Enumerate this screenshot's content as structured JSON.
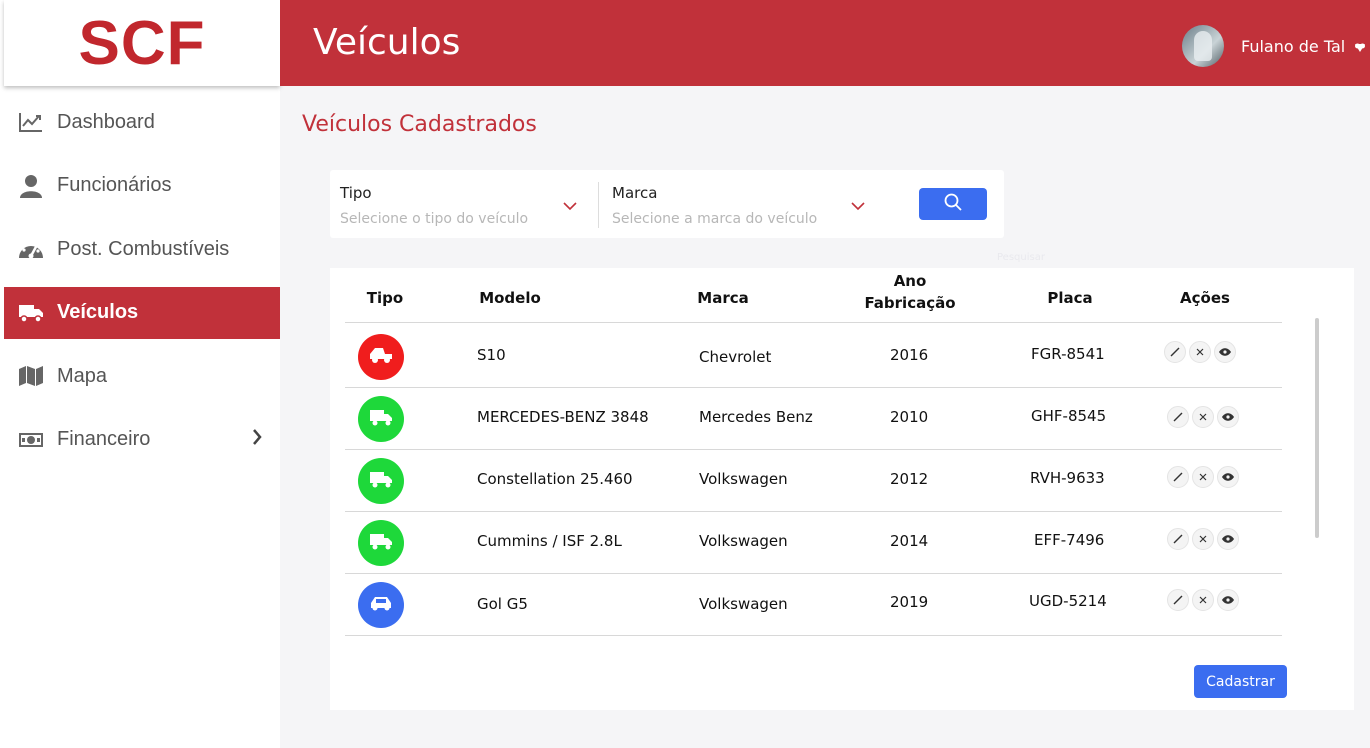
{
  "app": {
    "logo": "SCF"
  },
  "sidebar": {
    "items": [
      {
        "label": "Dashboard",
        "icon": "chart-line-icon",
        "active": false
      },
      {
        "label": "Funcionários",
        "icon": "user-icon",
        "active": false
      },
      {
        "label": "Post. Combustíveis",
        "icon": "gauge-icon",
        "active": false
      },
      {
        "label": "Veículos",
        "icon": "truck-icon",
        "active": true
      },
      {
        "label": "Mapa",
        "icon": "map-icon",
        "active": false
      },
      {
        "label": "Financeiro",
        "icon": "money-icon",
        "active": false,
        "has_submenu": true
      }
    ]
  },
  "header": {
    "title": "Veículos",
    "user": {
      "name": "Fulano de Tal",
      "avatar": "avatar-photo"
    }
  },
  "main": {
    "section_title": "Veículos Cadastrados",
    "filters": {
      "tipo": {
        "label": "Tipo",
        "placeholder": "Selecione o tipo do veículo"
      },
      "marca": {
        "label": "Marca",
        "placeholder": "Selecione a marca do veículo"
      },
      "search_button": {
        "icon": "search-icon"
      },
      "search_hint": "Pesquisar"
    },
    "table": {
      "headers": {
        "tipo": "Tipo",
        "modelo": "Modelo",
        "marca": "Marca",
        "ano_line1": "Ano",
        "ano_line2": "Fabricação",
        "placa": "Placa",
        "acoes": "Ações"
      },
      "rows": [
        {
          "tipo_icon": "pickup-icon",
          "tipo_color": "#f01d1d",
          "modelo": "S10",
          "marca": "Chevrolet",
          "ano": "2016",
          "placa": "FGR-8541"
        },
        {
          "tipo_icon": "truck-icon",
          "tipo_color": "#1ed83a",
          "modelo": "MERCEDES-BENZ 3848",
          "marca": "Mercedes Benz",
          "ano": "2010",
          "placa": "GHF-8545"
        },
        {
          "tipo_icon": "truck-icon",
          "tipo_color": "#1ed83a",
          "modelo": "Constellation 25.460",
          "marca": "Volkswagen",
          "ano": "2012",
          "placa": "RVH-9633"
        },
        {
          "tipo_icon": "truck-icon",
          "tipo_color": "#1ed83a",
          "modelo": "Cummins / ISF 2.8L",
          "marca": "Volkswagen",
          "ano": "2014",
          "placa": "EFF-7496"
        },
        {
          "tipo_icon": "car-icon",
          "tipo_color": "#3b6df0",
          "modelo": "Gol G5",
          "marca": "Volkswagen",
          "ano": "2019",
          "placa": "UGD-5214"
        }
      ],
      "row_actions": [
        "edit-icon",
        "delete-icon",
        "view-icon"
      ]
    },
    "cadastrar_label": "Cadastrar"
  },
  "colors": {
    "brand": "#c1313a",
    "primary_button": "#3b6df0",
    "status_red": "#f01d1d",
    "status_green": "#1ed83a",
    "status_blue": "#3b6df0"
  }
}
